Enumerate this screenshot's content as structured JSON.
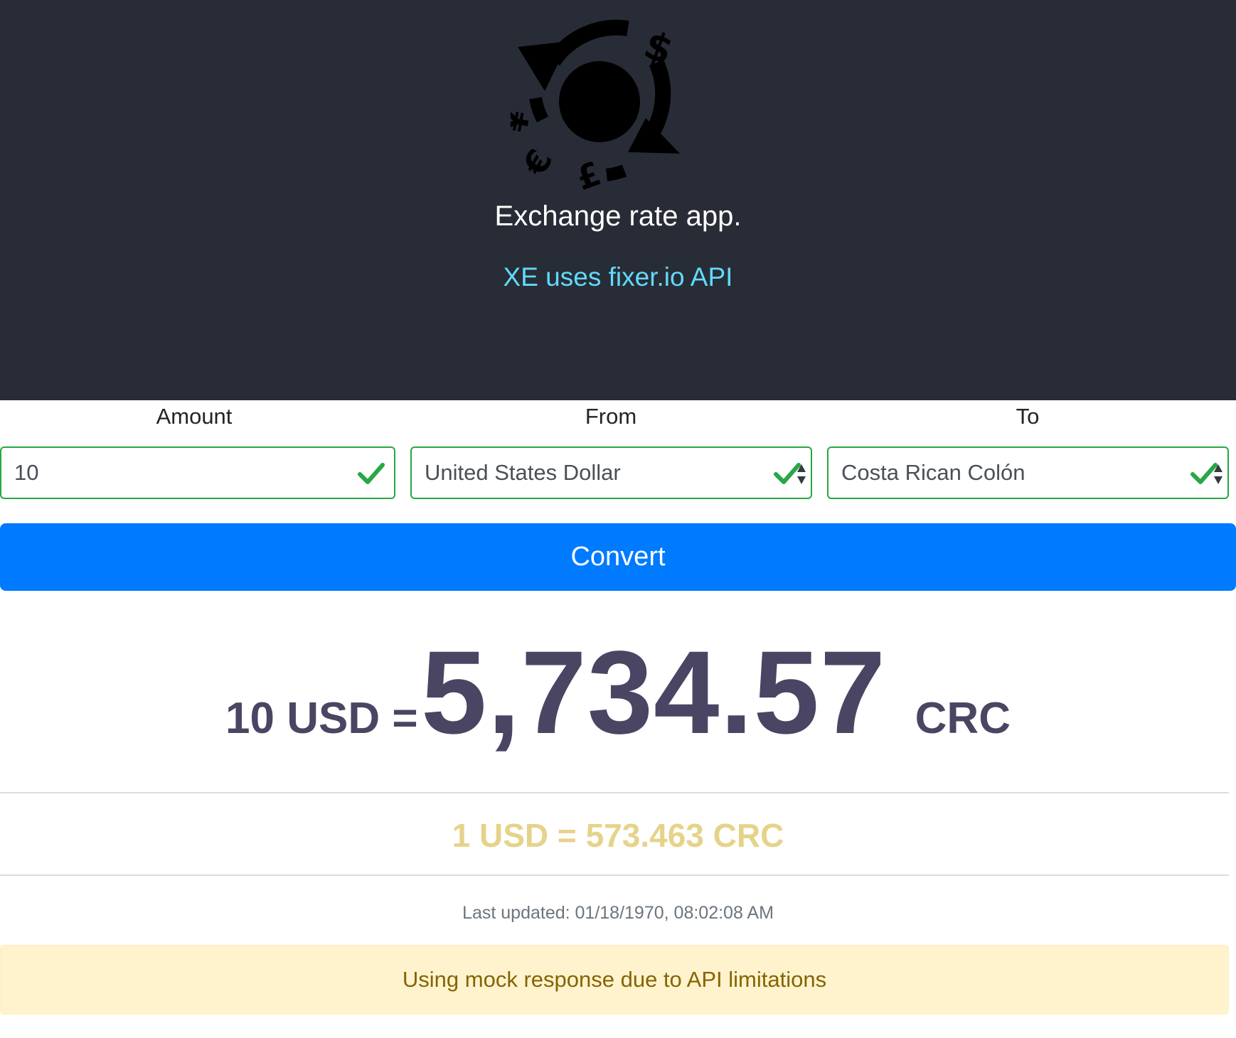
{
  "header": {
    "logo_icon": "currency-exchange-icon",
    "title": "Exchange rate app.",
    "api_link": "XE uses fixer.io API"
  },
  "form": {
    "amount": {
      "label": "Amount",
      "value": "10"
    },
    "from": {
      "label": "From",
      "value": "United States Dollar"
    },
    "to": {
      "label": "To",
      "value": "Costa Rican Colón"
    },
    "valid_color": "#28a745"
  },
  "convert_button": {
    "label": "Convert",
    "color": "#007bff"
  },
  "result": {
    "prefix": "10 USD =",
    "value": "5,734.57",
    "currency": "CRC",
    "color": "#4a4563"
  },
  "rate": {
    "text": "1 USD = 573.463 CRC",
    "color": "#e5d38a"
  },
  "last_updated": "Last updated: 01/18/1970, 08:02:08 AM",
  "alert": {
    "text": "Using mock response due to API limitations"
  }
}
